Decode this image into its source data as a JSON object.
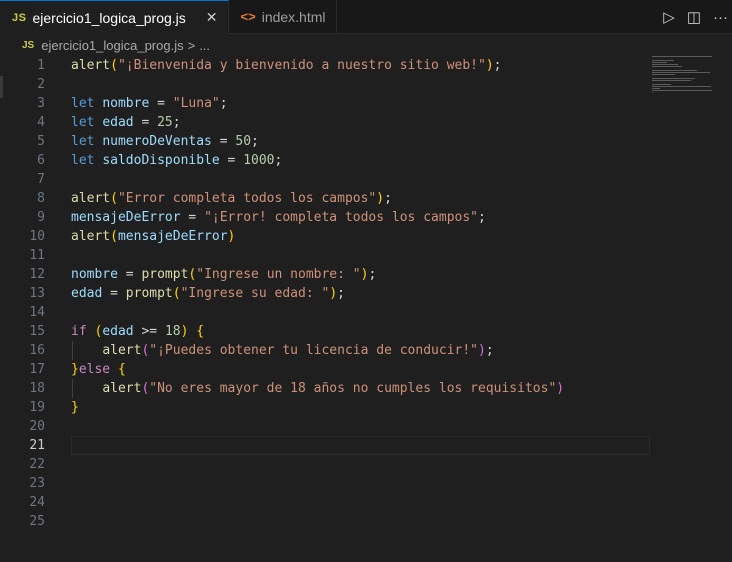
{
  "tabs": [
    {
      "badge": "JS",
      "label": "ejercicio1_logica_prog.js",
      "close": "✕",
      "active": true
    },
    {
      "badge": "<>",
      "label": "index.html",
      "active": false
    }
  ],
  "actions": {
    "run": "▷",
    "split": "◫",
    "more": "···"
  },
  "breadcrumb": {
    "badge": "JS",
    "file": "ejercicio1_logica_prog.js",
    "sep": ">",
    "more": "..."
  },
  "editor": {
    "current_line": 21,
    "line_numbers": [
      "1",
      "2",
      "3",
      "4",
      "5",
      "6",
      "7",
      "8",
      "9",
      "10",
      "11",
      "12",
      "13",
      "14",
      "15",
      "16",
      "17",
      "18",
      "19",
      "20",
      "21",
      "22",
      "23",
      "24",
      "25"
    ],
    "lines": [
      [
        {
          "t": "f",
          "v": "alert"
        },
        {
          "t": "b1",
          "v": "("
        },
        {
          "t": "s",
          "v": "\"¡Bienvenida y bienvenido a nuestro sitio web!\""
        },
        {
          "t": "b1",
          "v": ")"
        },
        {
          "t": "o",
          "v": ";"
        }
      ],
      [],
      [
        {
          "t": "k",
          "v": "let "
        },
        {
          "t": "v",
          "v": "nombre"
        },
        {
          "t": "o",
          "v": " = "
        },
        {
          "t": "s",
          "v": "\"Luna\""
        },
        {
          "t": "o",
          "v": ";"
        }
      ],
      [
        {
          "t": "k",
          "v": "let "
        },
        {
          "t": "v",
          "v": "edad"
        },
        {
          "t": "o",
          "v": " = "
        },
        {
          "t": "n",
          "v": "25"
        },
        {
          "t": "o",
          "v": ";"
        }
      ],
      [
        {
          "t": "k",
          "v": "let "
        },
        {
          "t": "v",
          "v": "numeroDeVentas"
        },
        {
          "t": "o",
          "v": " = "
        },
        {
          "t": "n",
          "v": "50"
        },
        {
          "t": "o",
          "v": ";"
        }
      ],
      [
        {
          "t": "k",
          "v": "let "
        },
        {
          "t": "v",
          "v": "saldoDisponible"
        },
        {
          "t": "o",
          "v": " = "
        },
        {
          "t": "n",
          "v": "1000"
        },
        {
          "t": "o",
          "v": ";"
        }
      ],
      [],
      [
        {
          "t": "f",
          "v": "alert"
        },
        {
          "t": "b1",
          "v": "("
        },
        {
          "t": "s",
          "v": "\"Error completa todos los campos\""
        },
        {
          "t": "b1",
          "v": ")"
        },
        {
          "t": "o",
          "v": ";"
        }
      ],
      [
        {
          "t": "v",
          "v": "mensajeDeError"
        },
        {
          "t": "o",
          "v": " = "
        },
        {
          "t": "s",
          "v": "\"¡Error! completa todos los campos\""
        },
        {
          "t": "o",
          "v": ";"
        }
      ],
      [
        {
          "t": "f",
          "v": "alert"
        },
        {
          "t": "b1",
          "v": "("
        },
        {
          "t": "v",
          "v": "mensajeDeError"
        },
        {
          "t": "b1",
          "v": ")"
        }
      ],
      [],
      [
        {
          "t": "v",
          "v": "nombre"
        },
        {
          "t": "o",
          "v": " = "
        },
        {
          "t": "f",
          "v": "prompt"
        },
        {
          "t": "b1",
          "v": "("
        },
        {
          "t": "s",
          "v": "\"Ingrese un nombre: \""
        },
        {
          "t": "b1",
          "v": ")"
        },
        {
          "t": "o",
          "v": ";"
        }
      ],
      [
        {
          "t": "v",
          "v": "edad"
        },
        {
          "t": "o",
          "v": " = "
        },
        {
          "t": "f",
          "v": "prompt"
        },
        {
          "t": "b1",
          "v": "("
        },
        {
          "t": "s",
          "v": "\"Ingrese su edad: \""
        },
        {
          "t": "b1",
          "v": ")"
        },
        {
          "t": "o",
          "v": ";"
        }
      ],
      [],
      [
        {
          "t": "kc",
          "v": "if "
        },
        {
          "t": "b1",
          "v": "("
        },
        {
          "t": "v",
          "v": "edad"
        },
        {
          "t": "o",
          "v": " >= "
        },
        {
          "t": "n",
          "v": "18"
        },
        {
          "t": "b1",
          "v": ")"
        },
        {
          "t": "o",
          "v": " "
        },
        {
          "t": "b1",
          "v": "{"
        }
      ],
      [
        {
          "t": "o",
          "v": "    "
        },
        {
          "t": "f",
          "v": "alert"
        },
        {
          "t": "b2",
          "v": "("
        },
        {
          "t": "s",
          "v": "\"¡Puedes obtener tu licencia de conducir!\""
        },
        {
          "t": "b2",
          "v": ")"
        },
        {
          "t": "o",
          "v": ";"
        }
      ],
      [
        {
          "t": "b1",
          "v": "}"
        },
        {
          "t": "kc",
          "v": "else"
        },
        {
          "t": "o",
          "v": " "
        },
        {
          "t": "b1",
          "v": "{"
        }
      ],
      [
        {
          "t": "o",
          "v": "    "
        },
        {
          "t": "f",
          "v": "alert"
        },
        {
          "t": "b2",
          "v": "("
        },
        {
          "t": "s",
          "v": "\"No eres mayor de 18 años no cumples los requisitos\""
        },
        {
          "t": "b2",
          "v": ")"
        }
      ],
      [
        {
          "t": "b1",
          "v": "}"
        }
      ],
      [],
      [],
      [],
      [],
      [],
      []
    ]
  }
}
